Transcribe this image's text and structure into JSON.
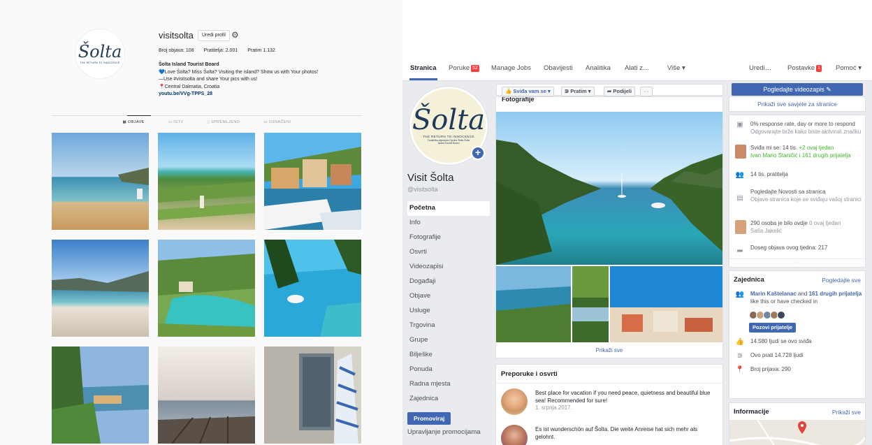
{
  "instagram": {
    "logo": {
      "wordmark": "Šolta",
      "tagline": "THE RETURN TO INNOCENCE"
    },
    "username": "visitsolta",
    "edit_profile": "Uredi profil",
    "stats": {
      "posts": "Broj objava: 108",
      "followers": "Pratitelja: 2.001",
      "following": "Pratim 1.132"
    },
    "bio": {
      "name": "Šolta Island Tourist Board",
      "line1": "💙Love Šolta? Miss Šolta? Visiting the island? Show us with Your photos!",
      "line2": "—Use #visitsolta and share Your pics with us!",
      "line3": "📍Central Dalmatia, Croatia",
      "link": "youtu.be/VVg-TPPS_28"
    },
    "tabs": [
      {
        "icon": "grid-icon",
        "label": "▦ OBJAVE"
      },
      {
        "icon": "igtv-icon",
        "label": "▭ IGTV"
      },
      {
        "icon": "bookmark-icon",
        "label": "▯ SPREMLJENO"
      },
      {
        "icon": "tag-icon",
        "label": "▭ OZNAČENI"
      }
    ]
  },
  "facebook": {
    "nav": {
      "page": "Stranica",
      "messages": "Poruke",
      "messages_badge": "52",
      "jobs": "Manage Jobs",
      "notifications": "Obavijesti",
      "analytics": "Analitika",
      "tools": "Alati z…",
      "more": "Više ▾",
      "edit": "Uredi…",
      "settings": "Postavke",
      "settings_badge": "1",
      "help": "Pomoć ▾"
    },
    "profile": {
      "wordmark": "Šolta",
      "tagline": "THE RETURN TO INNOCENCE",
      "tagline2": "Turistička zajednica Općine Šolta Šolta Island Tourist Board",
      "name": "Visit Šolta",
      "handle": "@visitsolta"
    },
    "menu": [
      "Početna",
      "Info",
      "Fotografije",
      "Osvrti",
      "Videozapisi",
      "Događaji",
      "Objave",
      "Usluge",
      "Trgovina",
      "Grupe",
      "Bilješke",
      "Ponuda",
      "Radna mjesta",
      "Zajednica"
    ],
    "promote": "Promoviraj",
    "manage_promotions": "Upravljanje promocijama",
    "actions": {
      "like": "👍 Sviđa vam se ▾",
      "follow": "⋑ Pratim ▾",
      "share": "➦ Podijeli",
      "more": "···"
    },
    "photos": {
      "header": "Fotografije",
      "show_all": "Prikaži sve"
    },
    "recommendations": {
      "header": "Preporuke i osvrti",
      "items": [
        {
          "text": "Best place for vacation if you need peace, quietness and beautiful blue sea! Recommended for sure!",
          "date": "1. srpnja 2017."
        },
        {
          "text": "Es ist wunderschön auf Šolta. Die weite Anreise hat sich mehr als gelohnt.",
          "date": ""
        }
      ]
    },
    "right": {
      "view_video": "Pogledajte videozapis ✎",
      "tips": "Prikaži sve savjete za stranice",
      "response": "0% response rate, day or more to respond",
      "response_sub": "Odgovarajte brže kako biste aktivirali značku",
      "likes": "Sviđa mi se: 14 tis.",
      "likes_week": "+2 ovaj tjedan",
      "likes_friends": "Ivan Mario Staničić i 161 drugih prijatelja",
      "followers": "14 tis. pratitelja",
      "news_title": "Pogledajte Novosti sa stranica",
      "news_sub": "Objave stranica koje se sviđaju vašoj stranici",
      "visited": "290 osoba je bilo ovdje",
      "visited_week": "0 ovaj tjedan",
      "visited_name": "Saša Jakelić",
      "reach": "Doseg objava ovog tjedna: 217",
      "community": "Zajednica",
      "see_all": "Pogledajte sve",
      "friends_a": "Marin Kaštelanac",
      "friends_b": " and ",
      "friends_c": "161 drugih prijatelja",
      "friends_d": "like this or have checked in",
      "invite": "Pozovi prijatelje",
      "total_likes": "14.580 ljudi se ovo sviđa",
      "total_follow": "Ovo prati 14.728 ljudi",
      "checkins": "Broj prijava: 290",
      "info": "Informacije",
      "info_link": "Prikaži sve"
    }
  },
  "colors": {
    "fb_blue": "#4267b2",
    "fb_bg": "#e9ebee",
    "ig_bg": "#fafafa",
    "badge_red": "#fa3e3e"
  }
}
